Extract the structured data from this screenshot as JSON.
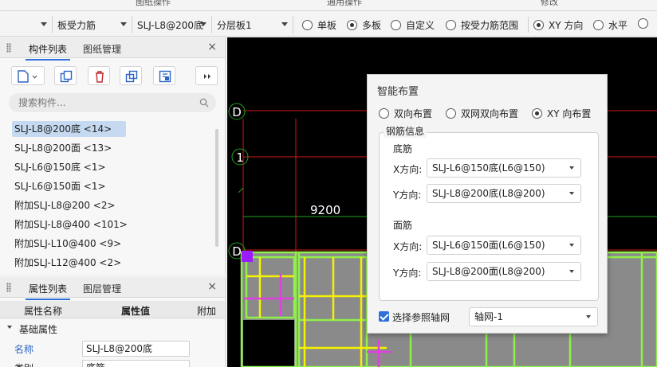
{
  "top_strip": {
    "label_1": "图纸操作",
    "label_2": "通用操作",
    "label_3": "修改"
  },
  "toolbar": {
    "select_1": "",
    "select_2": "板受力筋",
    "select_3": "SLJ-L8@200底",
    "select_4": "分层板1",
    "radios": [
      {
        "label": "单板",
        "checked": false
      },
      {
        "label": "多板",
        "checked": true
      },
      {
        "label": "自定义",
        "checked": false
      },
      {
        "label": "按受力筋范围",
        "checked": false
      },
      {
        "label": "XY 方向",
        "checked": true
      },
      {
        "label": "水平",
        "checked": false
      }
    ]
  },
  "components_panel": {
    "tab_active": "构件列表",
    "tab_other": "图纸管理",
    "close": "×",
    "search_placeholder": "搜索构件...",
    "items": [
      "SLJ-L8@200底 <14>",
      "SLJ-L8@200面 <13>",
      "SLJ-L6@150底 <1>",
      "SLJ-L6@150面 <1>",
      "附加SLJ-L8@200 <2>",
      "附加SLJ-L8@400 <101>",
      "附加SLJ-L10@400 <9>",
      "附加SLJ-L12@400 <2>"
    ],
    "selected_index": 0
  },
  "properties_panel": {
    "tab_active": "属性列表",
    "tab_other": "图层管理",
    "close": "×",
    "col_name": "属性名称",
    "col_value": "属性值",
    "col_extra": "附加",
    "group": "基础属性",
    "rows": [
      {
        "name": "名称",
        "value": "SLJ-L8@200底"
      },
      {
        "name": "类别",
        "value": "底筋"
      }
    ]
  },
  "canvas": {
    "axis_labels": [
      "D",
      "1",
      "D"
    ],
    "dimension": "9200",
    "grid_color": "#8ff04a",
    "highlight_color": "#f5f200",
    "bar_color": "#e040e0",
    "line_color": "#d11818"
  },
  "dialog": {
    "title": "智能布置",
    "radios": [
      {
        "label": "双向布置",
        "checked": false
      },
      {
        "label": "双网双向布置",
        "checked": false
      },
      {
        "label": "XY 向布置",
        "checked": true
      }
    ],
    "group_label": "钢筋信息",
    "bottom": {
      "label": "底筋",
      "x_label": "X方向:",
      "x_value": "SLJ-L6@150底(L6@150)",
      "y_label": "Y方向:",
      "y_value": "SLJ-L8@200底(L8@200)"
    },
    "top": {
      "label": "面筋",
      "x_label": "X方向:",
      "x_value": "SLJ-L6@150面(L6@150)",
      "y_label": "Y方向:",
      "y_value": "SLJ-L8@200面(L8@200)"
    },
    "checkbox_label": "选择参照轴网",
    "checkbox_checked": true,
    "axis_value": "轴网-1"
  }
}
